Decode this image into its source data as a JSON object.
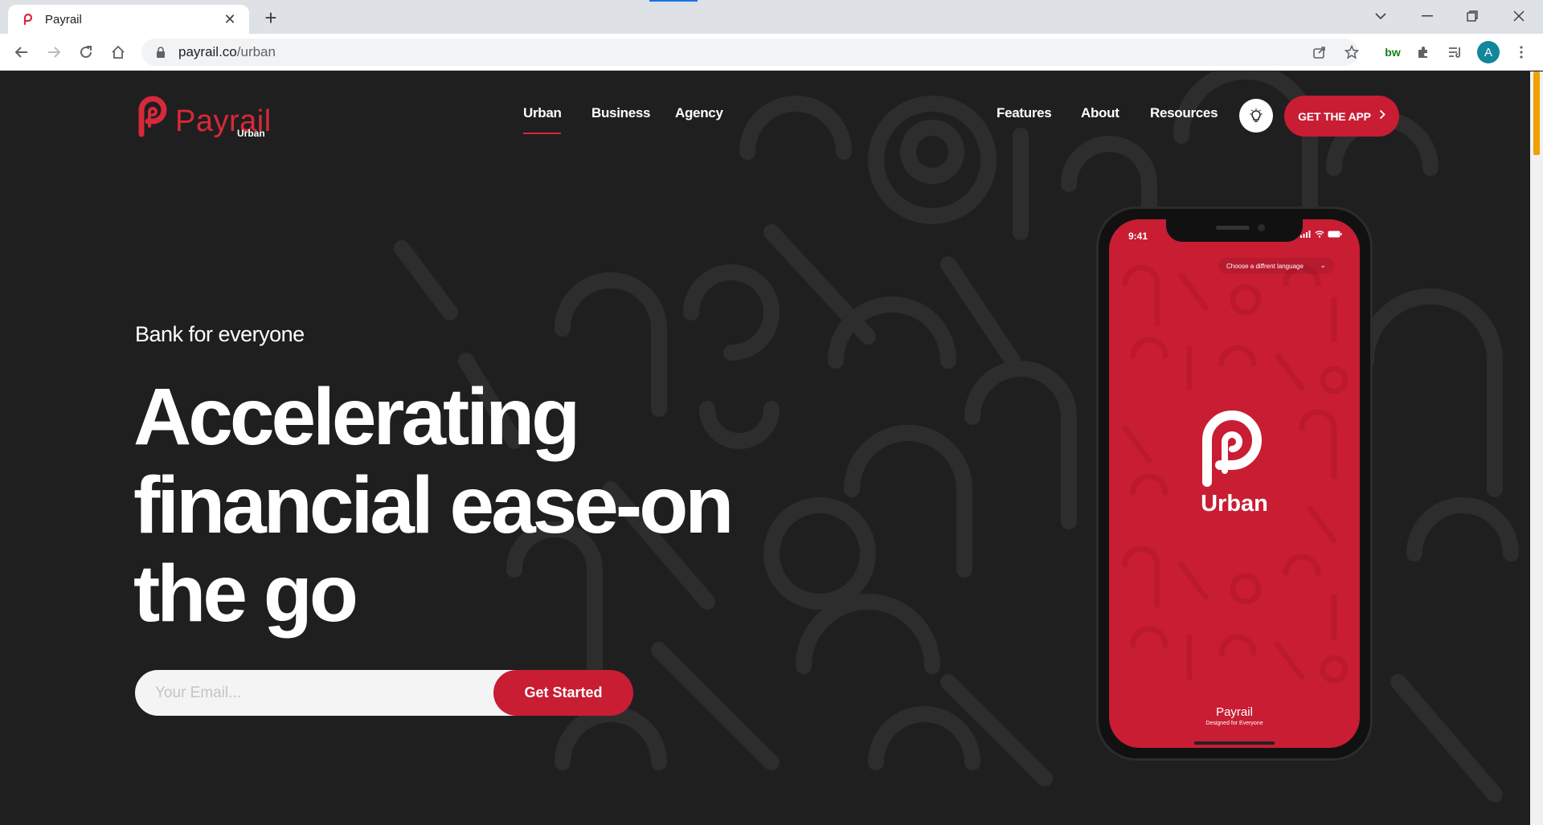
{
  "browser": {
    "tab_title": "Payrail",
    "url_host": "payrail.co",
    "url_path": "/urban",
    "ext_bw": "bw",
    "avatar_letter": "A"
  },
  "header": {
    "logo_text": "Payrail",
    "logo_sub": "Urban",
    "nav_left": [
      "Urban",
      "Business",
      "Agency"
    ],
    "nav_right": [
      "Features",
      "About",
      "Resources"
    ],
    "active_nav": "Urban",
    "cta_label": "GET THE APP"
  },
  "hero": {
    "eyebrow": "Bank for everyone",
    "headline_line1": "Accelerating",
    "headline_line2": "financial ease-on",
    "headline_line3": "the go",
    "email_placeholder": "Your Email...",
    "submit_label": "Get Started"
  },
  "phone": {
    "time": "9:41",
    "language_label": "Choose a diffrent language",
    "app_name": "Urban",
    "footer_brand": "Payrail",
    "footer_tagline": "Designed for Everyone"
  },
  "colors": {
    "brand_red": "#c81d33",
    "page_bg": "#1f1f20",
    "pattern_stroke": "#2d2d2e"
  },
  "icons": [
    "payrail-favicon",
    "close-icon",
    "plus-icon",
    "chevron-down-icon",
    "minimize-icon",
    "restore-icon",
    "window-close-icon",
    "back-arrow-icon",
    "forward-arrow-icon",
    "reload-icon",
    "home-icon",
    "lock-icon",
    "share-icon",
    "star-icon",
    "extensions-icon",
    "reading-list-icon",
    "more-menu-icon",
    "lightbulb-icon"
  ]
}
